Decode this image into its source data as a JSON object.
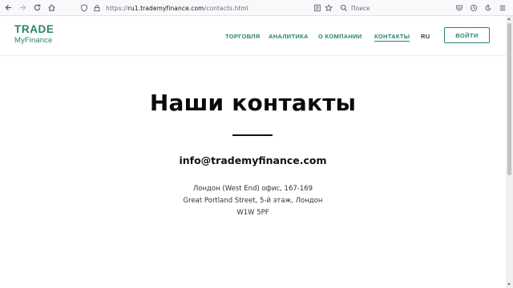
{
  "browser": {
    "url_host": "ru1.trademyfinance.com",
    "url_prefix": "https://",
    "url_path": "/contacts.html",
    "search_placeholder": "Поиск",
    "icons": [
      "back-icon",
      "forward-icon",
      "reload-icon",
      "home-icon",
      "shield-icon",
      "lock-icon",
      "reader-icon",
      "star-icon",
      "search-icon",
      "pocket-icon",
      "history-icon",
      "sync-icon",
      "menu-icon"
    ]
  },
  "header": {
    "logo_top": "TRADE",
    "logo_bottom": "MyFinance",
    "nav": [
      {
        "label": "ТОРГОВЛЯ"
      },
      {
        "label": "АНАЛИТИКА"
      },
      {
        "label": "О КОМПАНИИ"
      },
      {
        "label": "КОНТАКТЫ"
      }
    ],
    "lang": "RU",
    "login_label": "ВОЙТИ",
    "accent_color": "#2a8270"
  },
  "main": {
    "title": "Наши контакты",
    "email": "info@trademyfinance.com",
    "address_lines": [
      "Лондон (West End) офис, 167-169",
      "Great Portland Street, 5-й этаж, Лондон",
      "W1W 5PF"
    ]
  }
}
